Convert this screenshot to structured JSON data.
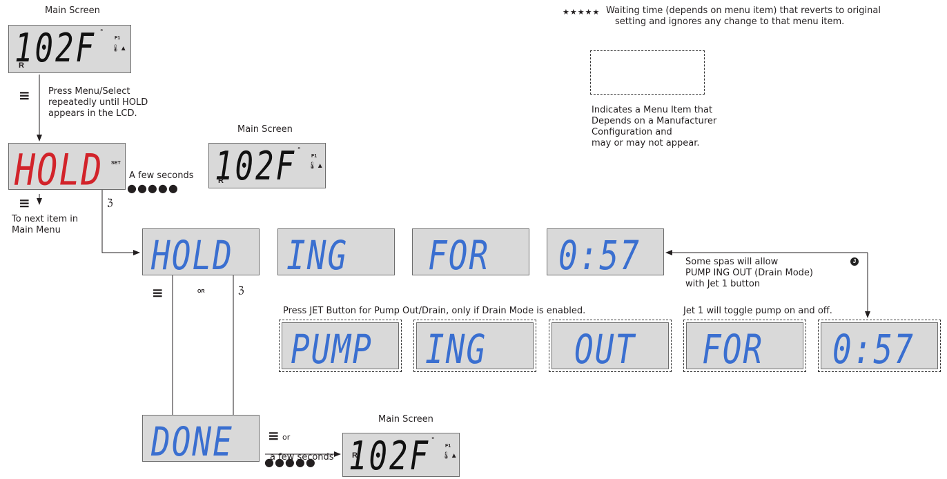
{
  "labels": {
    "main_screen": "Main Screen",
    "press_menu_1": "Press Menu/Select",
    "press_menu_2": "repeatedly until HOLD",
    "press_menu_3": "appears in the LCD.",
    "a_few_seconds": "A few seconds",
    "to_next_1": "To next item in",
    "to_next_2": "Main Menu",
    "or_small": "OR",
    "or": "or",
    "a_few_seconds_lower": "a few seconds",
    "press_jet": "Press JET Button for Pump Out/Drain, only if Drain Mode is enabled.",
    "some_spas_1": "Some spas will allow",
    "some_spas_2": "PUMP ING OUT (Drain Mode)",
    "some_spas_3": "with Jet 1 button",
    "jet1_toggle": "Jet 1 will toggle pump on and off.",
    "legend_stars": "★★★★★",
    "legend_wait_1": "Waiting time (depends on menu item) that reverts to original",
    "legend_wait_2": "setting and ignores any change to that menu item.",
    "legend_dep_1": "Indicates a Menu Item that",
    "legend_dep_2": "Depends on a Manufacturer",
    "legend_dep_3": "Configuration and",
    "legend_dep_4": "may or may not appear.",
    "dots": "●●●●●"
  },
  "lcd": {
    "main_temp": "102F",
    "main_f1": "F1",
    "main_r": "R",
    "main_deg": "°",
    "main_therm": "🌡▲",
    "hold_red": "HOLD",
    "set": "SET",
    "hold": "HOLD",
    "ing": "ING",
    "for": "FOR",
    "time": "0:57",
    "pump": "PUMP",
    "out": "OUT",
    "done": "DONE",
    "jet_badge": "J"
  },
  "icons": {
    "menu": "≡",
    "jet": "ℨ"
  },
  "colors": {
    "lcd_blue": "#3a6fd0",
    "lcd_red": "#d2232a",
    "lcd_bg": "#d9d9d9"
  }
}
